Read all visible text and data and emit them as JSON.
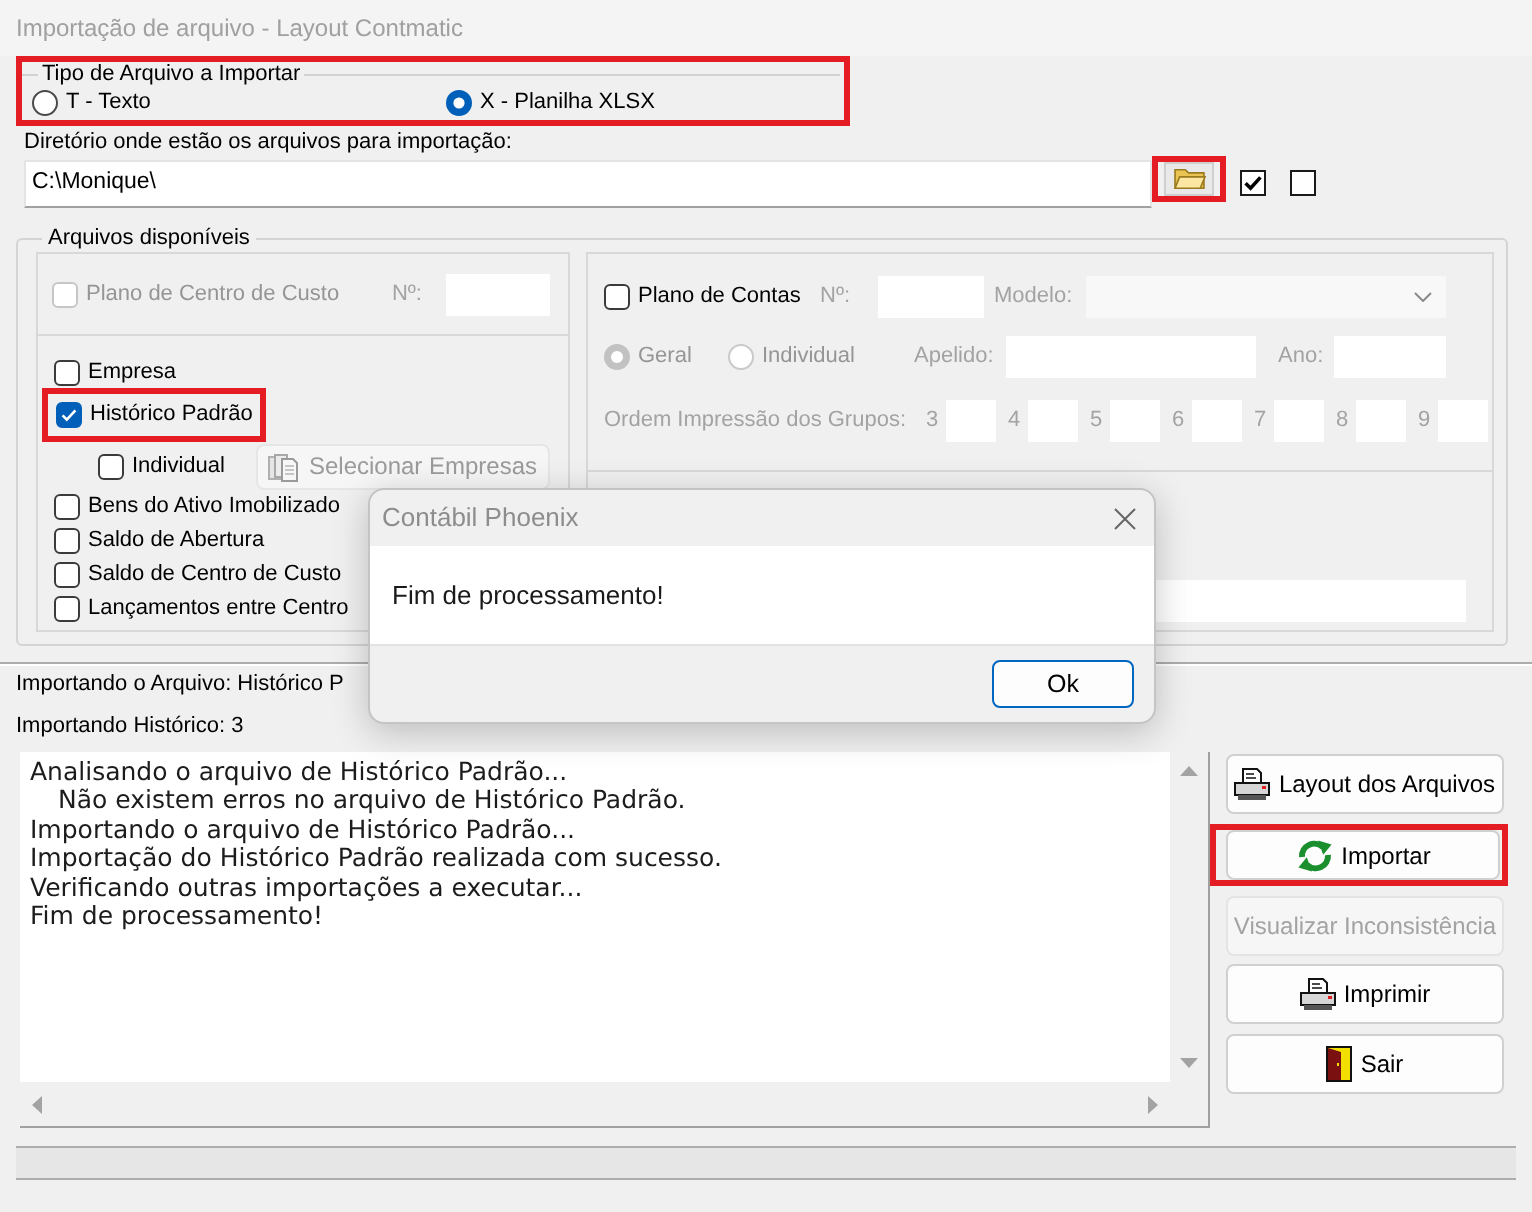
{
  "window": {
    "title": "Importação de arquivo - Layout Contmatic"
  },
  "file_type": {
    "legend": "Tipo de Arquivo a Importar",
    "highlighted": true,
    "options": [
      {
        "label": "T - Texto",
        "selected": false
      },
      {
        "label": "X - Planilha XLSX",
        "selected": true
      }
    ]
  },
  "directory": {
    "label": "Diretório onde estão os arquivos para importação:",
    "value": "C:\\Monique\\",
    "folder_button": {
      "highlighted": true
    },
    "checkboxes": [
      {
        "checked": true
      },
      {
        "checked": false
      }
    ]
  },
  "available_files": {
    "legend": "Arquivos disponíveis",
    "cost_center_plan": {
      "label": "Plano de Centro de Custo",
      "checked": false,
      "disabled": true,
      "number_label": "Nº:"
    },
    "items": [
      {
        "kind": "checkbox",
        "label": "Empresa",
        "checked": false,
        "highlighted": false
      },
      {
        "kind": "checkbox",
        "label": "Histórico Padrão",
        "checked": true,
        "highlighted": true
      },
      {
        "kind": "sub_option",
        "label": "Individual",
        "checked": false,
        "button": {
          "label": "Selecionar Empresas",
          "disabled": true
        }
      },
      {
        "kind": "checkbox",
        "label": "Bens do Ativo Imobilizado",
        "checked": false,
        "highlighted": false
      },
      {
        "kind": "checkbox",
        "label": "Saldo de Abertura",
        "checked": false,
        "highlighted": false
      },
      {
        "kind": "checkbox",
        "label": "Saldo de Centro de Custo",
        "checked": false,
        "highlighted": false
      },
      {
        "kind": "checkbox",
        "label": "Lançamentos entre Centro",
        "checked": false,
        "highlighted": false
      }
    ],
    "chart_of_accounts": {
      "label": "Plano de Contas",
      "checked": false,
      "details_disabled": true,
      "number_label": "Nº:",
      "model_label": "Modelo:",
      "scope_options": [
        {
          "label": "Geral",
          "selected": true
        },
        {
          "label": "Individual",
          "selected": false
        }
      ],
      "nickname_label": "Apelido:",
      "year_label": "Ano:",
      "group_order_label": "Ordem Impressão dos Grupos:",
      "group_numbers": [
        "3",
        "4",
        "5",
        "6",
        "7",
        "8",
        "9"
      ]
    }
  },
  "status": {
    "file_line": "Importando o Arquivo: Histórico P",
    "count_line": "Importando Histórico: 3"
  },
  "log": {
    "lines": [
      {
        "text": "Analisando o arquivo de Histórico Padrão...",
        "indented": false
      },
      {
        "text": "Não existem erros no arquivo de Histórico Padrão.",
        "indented": true
      },
      {
        "text": "Importando o arquivo de Histórico Padrão...",
        "indented": false
      },
      {
        "text": "Importação do Histórico Padrão realizada com sucesso.",
        "indented": false
      },
      {
        "text": "Verificando outras importações a executar...",
        "indented": false
      },
      {
        "text": "Fim de processamento!",
        "indented": false
      }
    ]
  },
  "buttons": [
    {
      "label": "Layout dos Arquivos",
      "disabled": false,
      "highlighted": false
    },
    {
      "label": "Importar",
      "disabled": false,
      "highlighted": true
    },
    {
      "label": "Visualizar Inconsistência",
      "disabled": true,
      "highlighted": false
    },
    {
      "label": "Imprimir",
      "disabled": false,
      "highlighted": false
    },
    {
      "label": "Sair",
      "disabled": false,
      "highlighted": false
    }
  ],
  "dialog": {
    "title": "Contábil Phoenix",
    "message": "Fim de processamento!",
    "button": "Ok"
  }
}
